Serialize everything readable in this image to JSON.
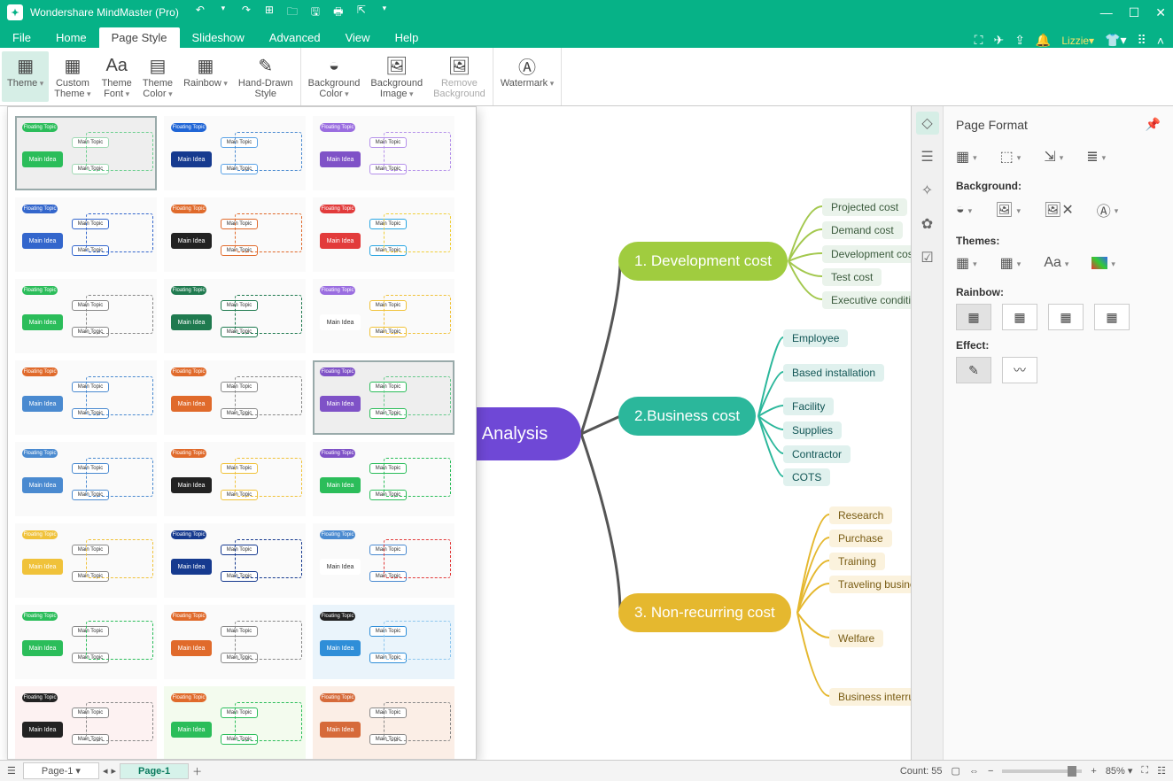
{
  "app": {
    "title": "Wondershare MindMaster (Pro)",
    "user": "Lizzie"
  },
  "menus": {
    "file": "File",
    "home": "Home",
    "pagestyle": "Page Style",
    "slideshow": "Slideshow",
    "advanced": "Advanced",
    "view": "View",
    "help": "Help"
  },
  "ribbon": {
    "theme": "Theme",
    "custom": "Custom\nTheme",
    "font": "Theme\nFont",
    "color": "Theme\nColor",
    "rainbow": "Rainbow",
    "hand": "Hand-Drawn\nStyle",
    "bgcolor": "Background\nColor",
    "bgimage": "Background\nImage",
    "removebg": "Remove\nBackground",
    "watermark": "Watermark"
  },
  "mindmap": {
    "root": "Analysis",
    "b1": {
      "label": "1.  Development cost",
      "leaves": [
        "Projected cost",
        "Demand cost",
        "Development cost",
        "Test cost",
        "Executive condition"
      ]
    },
    "b2": {
      "label": "2.Business cost",
      "leaves": [
        "Employee",
        "Based installation",
        "Facility",
        "Supplies",
        "Contractor",
        "COTS"
      ]
    },
    "b3": {
      "label": "3.  Non-recurring cost",
      "leaves": [
        "Research",
        "Purchase",
        "Training",
        "Traveling busines",
        "Welfare",
        "Business interru"
      ]
    }
  },
  "rpanel": {
    "title": "Page Format",
    "bg": "Background:",
    "themes": "Themes:",
    "rainbow": "Rainbow:",
    "effect": "Effect:"
  },
  "status": {
    "page1": "Page-1",
    "page1b": "Page-1",
    "count": "Count: 55",
    "zoom": "85%"
  },
  "gallery": {
    "float": "Floating Topic",
    "main": "Main Idea",
    "sub": "Main Topic",
    "themes": [
      {
        "main": "#2bbd5a",
        "float": "#2bbd5a",
        "sub": "#a0d9b4",
        "dash": "#6ccf8f",
        "sel": true
      },
      {
        "main": "#163a8f",
        "float": "#1f65d6",
        "sub": "#5aa2e6",
        "dash": "#4a8ad0"
      },
      {
        "main": "#7f52c7",
        "float": "#9a6de0",
        "sub": "#b591ea",
        "dash": "#b591ea"
      },
      {
        "main": "#3366cc",
        "float": "#3366cc",
        "sub": "#3366cc",
        "dash": "#3366cc"
      },
      {
        "main": "#222",
        "float": "#e06a2b",
        "sub": "#e06a2b",
        "dash": "#e06a2b"
      },
      {
        "main": "#e23b3b",
        "float": "#e23b3b",
        "sub": "#2aa6e2",
        "dash": "#f0cf3a"
      },
      {
        "main": "#2bbd5a",
        "float": "#2bbd5a",
        "sub": "#888",
        "dash": "#888"
      },
      {
        "main": "#1f7a4f",
        "float": "#1f7a4f",
        "sub": "#1f7a4f",
        "dash": "#1f7a4f"
      },
      {
        "main": "#fff",
        "float": "#9a6de0",
        "sub": "#f0c23a",
        "dash": "#f0c23a",
        "mt": "#333"
      },
      {
        "main": "#4a8ad0",
        "float": "#e06a2b",
        "sub": "#4a8ad0",
        "dash": "#4a8ad0"
      },
      {
        "main": "#e06a2b",
        "float": "#e06a2b",
        "sub": "#888",
        "dash": "#888"
      },
      {
        "main": "#7f52c7",
        "float": "#7f52c7",
        "sub": "#2bbd5a",
        "dash": "#65c98a",
        "sel": true
      },
      {
        "main": "#4a8ad0",
        "float": "#4a8ad0",
        "sub": "#4a8ad0",
        "dash": "#4a8ad0"
      },
      {
        "main": "#222",
        "float": "#e06a2b",
        "sub": "#f0c23a",
        "dash": "#f0c23a"
      },
      {
        "main": "#2bbd5a",
        "float": "#7f52c7",
        "sub": "#2bbd5a",
        "dash": "#2bbd5a"
      },
      {
        "main": "#f0c23a",
        "float": "#f0c23a",
        "sub": "#888",
        "dash": "#f0c23a"
      },
      {
        "main": "#163a8f",
        "float": "#163a8f",
        "sub": "#163a8f",
        "dash": "#163a8f"
      },
      {
        "main": "#fff",
        "float": "#4a8ad0",
        "sub": "#4a8ad0",
        "dash": "#e23b3b",
        "mt": "#333"
      },
      {
        "main": "#2bbd5a",
        "float": "#2bbd5a",
        "sub": "#888",
        "dash": "#2bbd5a"
      },
      {
        "main": "#e06a2b",
        "float": "#e06a2b",
        "sub": "#888",
        "dash": "#888"
      },
      {
        "main": "#2f8ed8",
        "float": "#222",
        "sub": "#2f8ed8",
        "dash": "#8ec7ef",
        "bg": "#eaf4fb"
      },
      {
        "main": "#222",
        "float": "#222",
        "sub": "#888",
        "dash": "#888",
        "bg": "#fdf2f2"
      },
      {
        "main": "#2bbd5a",
        "float": "#e06a2b",
        "sub": "#2bbd5a",
        "dash": "#2bbd5a",
        "bg": "#f3fbee"
      },
      {
        "main": "#d66a3a",
        "float": "#d66a3a",
        "sub": "#888",
        "dash": "#888",
        "bg": "#fbeee6"
      }
    ]
  }
}
